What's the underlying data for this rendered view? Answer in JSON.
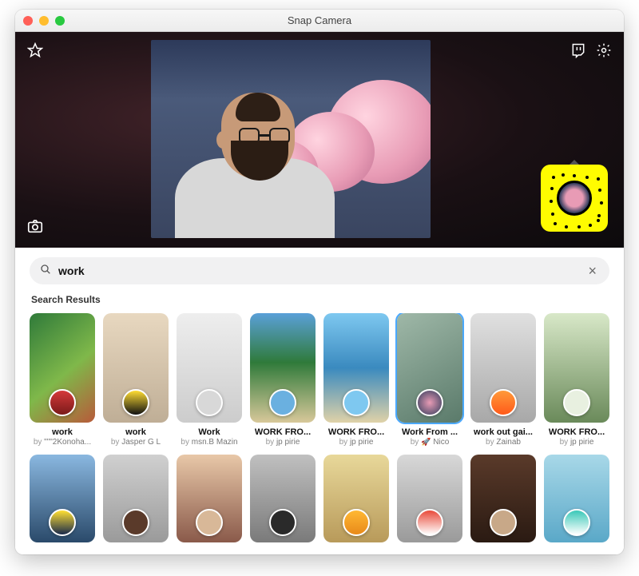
{
  "window": {
    "title": "Snap Camera"
  },
  "search": {
    "query": "work",
    "results_label": "Search Results"
  },
  "author_prefix": "by ",
  "lenses_row1": [
    {
      "name": "work",
      "author": "\"\"\"2Konoha...",
      "bg": "linear-gradient(140deg,#2f7a3a 0%,#7fb84a 55%,#b85a3a 100%)",
      "badge": "linear-gradient(#d43a3a,#7a1a1a)",
      "selected": false
    },
    {
      "name": "work",
      "author": "Jasper G L",
      "bg": "linear-gradient(#e8d8c0,#bfae96)",
      "badge": "linear-gradient(#ffdd33,#111)",
      "selected": false
    },
    {
      "name": "Work",
      "author": "msn.B Mazin",
      "bg": "linear-gradient(#eee,#ccc)",
      "badge": "#d8d8d8",
      "selected": false
    },
    {
      "name": "WORK FRO...",
      "author": "jp pirie",
      "bg": "linear-gradient(180deg,#5aa0d8 0%,#2f7a3a 45%,#d8c89a 100%)",
      "badge": "#6ab0e0",
      "selected": false
    },
    {
      "name": "WORK FRO...",
      "author": "jp pirie",
      "bg": "linear-gradient(180deg,#7ec8f0 0%,#3a8abf 50%,#e0d2a8 100%)",
      "badge": "#7ec8f0",
      "selected": false
    },
    {
      "name": "Work From ...",
      "author": "🚀 Nico",
      "bg": "linear-gradient(150deg,#9fb8a8,#5a7a6a)",
      "badge": "radial-gradient(#e89bb5,#2d3a5a)",
      "selected": true
    },
    {
      "name": "work out gai...",
      "author": "Zainab",
      "bg": "linear-gradient(#e0e0e0,#a8a8a8)",
      "badge": "linear-gradient(#ff9a3a,#ff5a1a)",
      "selected": false
    },
    {
      "name": "WORK FRO...",
      "author": "jp pirie",
      "bg": "linear-gradient(#d8e8c8,#6a8a5a)",
      "badge": "#e8f0e0",
      "selected": false
    }
  ],
  "lenses_row2": [
    {
      "bg": "linear-gradient(#8ab8e0,#2a4a6a)",
      "badge": "linear-gradient(#ffe033,#1a2a4a)"
    },
    {
      "bg": "linear-gradient(#d0d0d0,#9a9a9a)",
      "badge": "#5a3a2a"
    },
    {
      "bg": "linear-gradient(#e8c8a8,#8a5a4a)",
      "badge": "#d8b898"
    },
    {
      "bg": "linear-gradient(#c0c0c0,#7a7a7a)",
      "badge": "#2a2a2a"
    },
    {
      "bg": "linear-gradient(#e8d89a,#b89a5a)",
      "badge": "linear-gradient(#ffb833,#e88a1a)"
    },
    {
      "bg": "linear-gradient(#d8d8d8,#9a9a9a)",
      "badge": "linear-gradient(#e84a3a,#fff)"
    },
    {
      "bg": "linear-gradient(#5a3a2a,#2a1a12)",
      "badge": "#c8a888"
    },
    {
      "bg": "linear-gradient(#a8d8e8,#5aa8c8)",
      "badge": "linear-gradient(#3ac8b8,#fff)"
    }
  ]
}
